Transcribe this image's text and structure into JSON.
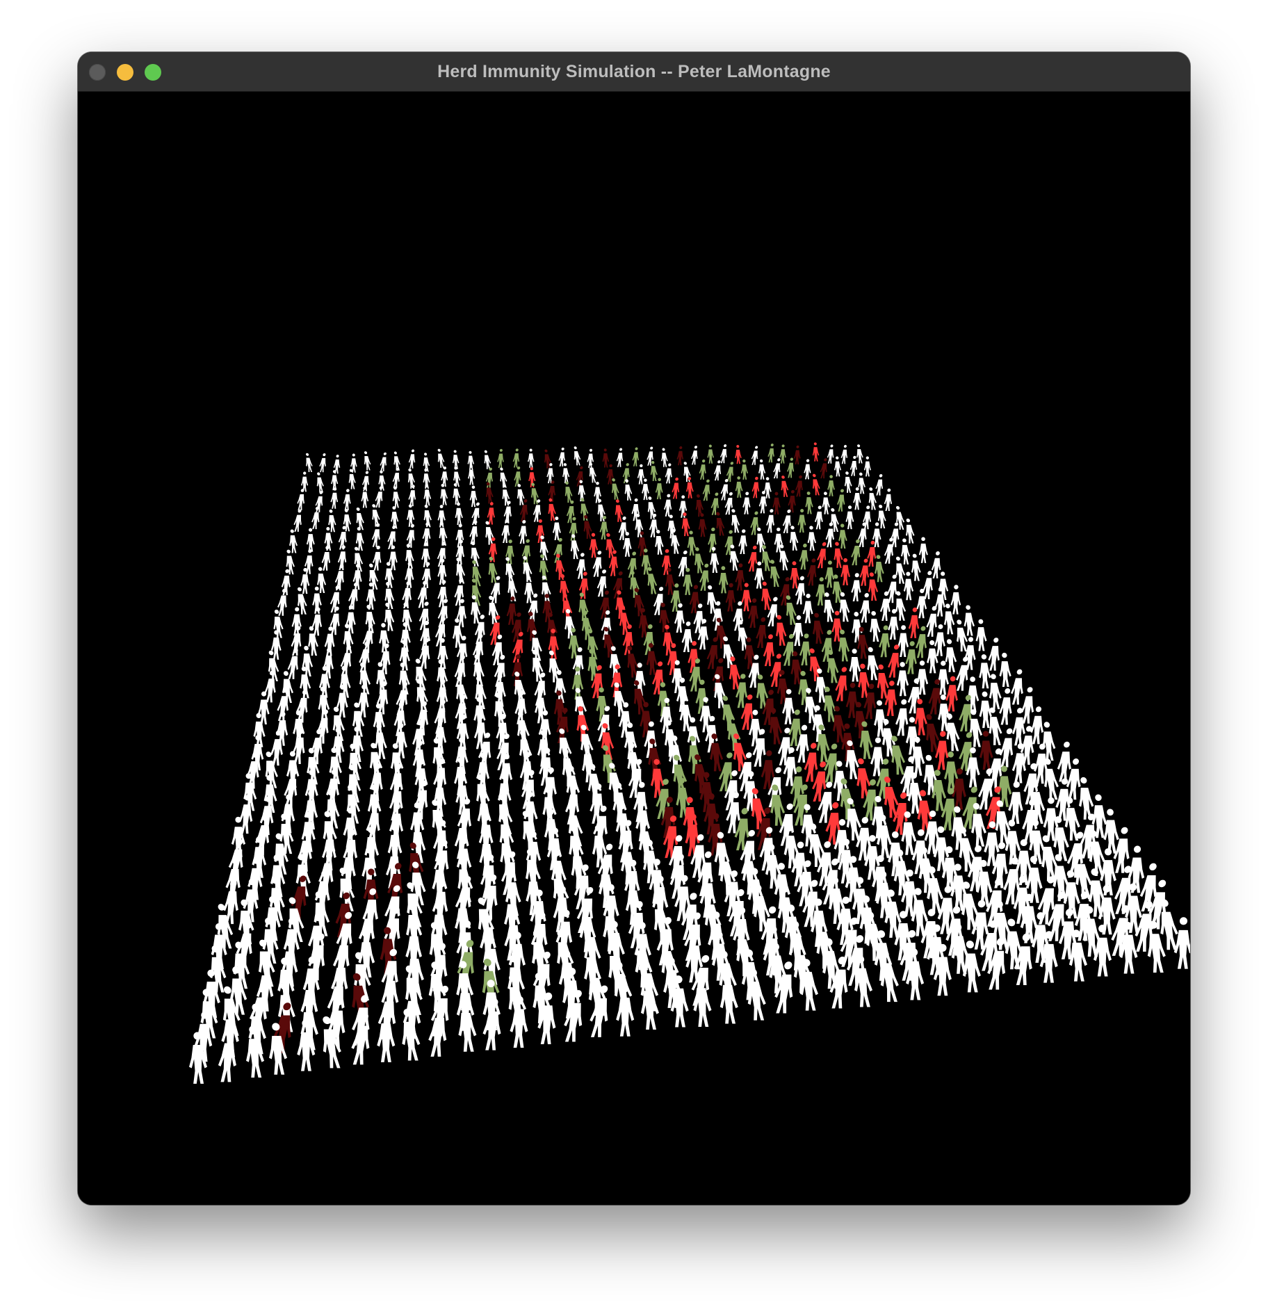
{
  "window": {
    "title": "Herd Immunity Simulation -- Peter LaMontagne"
  },
  "simulation": {
    "grid_rows": 29,
    "grid_cols": 38,
    "state_colors": {
      "healthy": "#ffffff",
      "infected": "#ff3a3a",
      "recovered": "#8fad66",
      "deceased": "#5a0a0a"
    },
    "figure_icon": "standing-person-silhouette"
  }
}
